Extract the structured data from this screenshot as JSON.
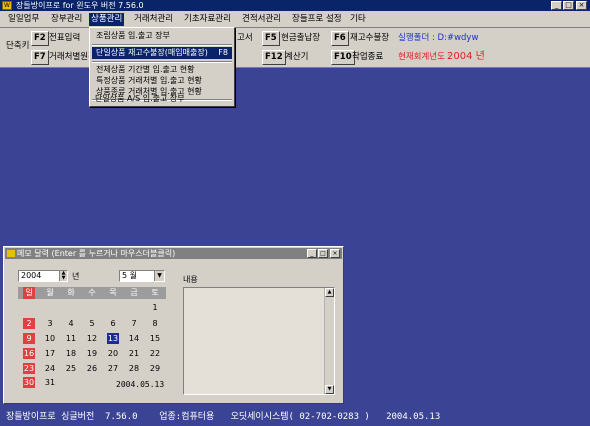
{
  "window": {
    "title": "장들방이프로 for 윈도우 버전 7.56.0",
    "min": "_",
    "max": "□",
    "close": "×"
  },
  "menu": [
    "일일업무",
    "장부관리",
    "상품관리",
    "거래처관리",
    "기초자료관리",
    "견적서관리",
    "장들프로 설정",
    "기타"
  ],
  "toolbar": {
    "section_label": "단축키",
    "row1": [
      {
        "key": "F2",
        "label": "전표입력"
      },
      {
        "key": "",
        "label": "고서"
      },
      {
        "key": "F5",
        "label": "현금출납장"
      },
      {
        "key": "F6",
        "label": "재고수불장"
      }
    ],
    "row2": [
      {
        "key": "F7",
        "label": "거래처별원장"
      },
      {
        "key": "F12",
        "label": "계산기"
      },
      {
        "key": "F10",
        "label": "작업종료"
      }
    ],
    "data_folder": "실행폴더 : D:#wdyw",
    "fiscal_year_label": "현재회계년도 :",
    "fiscal_year": "2004  년"
  },
  "dropdown": {
    "items": [
      {
        "label": "조립상품 입.출고 장부",
        "key": ""
      },
      {
        "label": "단일상품 재고수불장(매입매출장)",
        "key": "F8"
      },
      {
        "label": "전체상품 기간별 입.출고 현황",
        "key": ""
      },
      {
        "label": "특정상품 거래처별 입.출고 현황",
        "key": ""
      },
      {
        "label": "상품종류 거래처별 입.출고 현황",
        "key": ""
      },
      {
        "label": "단일상품 A/S 입.출고 장부",
        "key": ""
      }
    ]
  },
  "memo": {
    "title": "메모 달력 (Enter 를 누르거나 마우스더블클릭)",
    "year": "2004",
    "year_unit": "년",
    "month": "5 월",
    "weekdays": [
      "일",
      "월",
      "화",
      "수",
      "목",
      "금",
      "토"
    ],
    "days": [
      "1",
      "2",
      "3",
      "4",
      "5",
      "6",
      "7",
      "8",
      "9",
      "10",
      "11",
      "12",
      "13",
      "14",
      "15",
      "16",
      "17",
      "18",
      "19",
      "20",
      "21",
      "22",
      "23",
      "24",
      "25",
      "26",
      "27",
      "28",
      "29",
      "30",
      "31"
    ],
    "selected_date": "2004.05.13",
    "content_label": "내용",
    "content": ""
  },
  "status": {
    "text": "장들방이프로 싱글버전  7.56.0    업종:컴퓨터용   오딧세이시스템( 02-702-0283 )   2004.05.13"
  },
  "colors": {
    "desktop": "#3b4494",
    "highlight": "#0a246a",
    "sunday": "#e24040",
    "today": "#1c2a9a"
  }
}
